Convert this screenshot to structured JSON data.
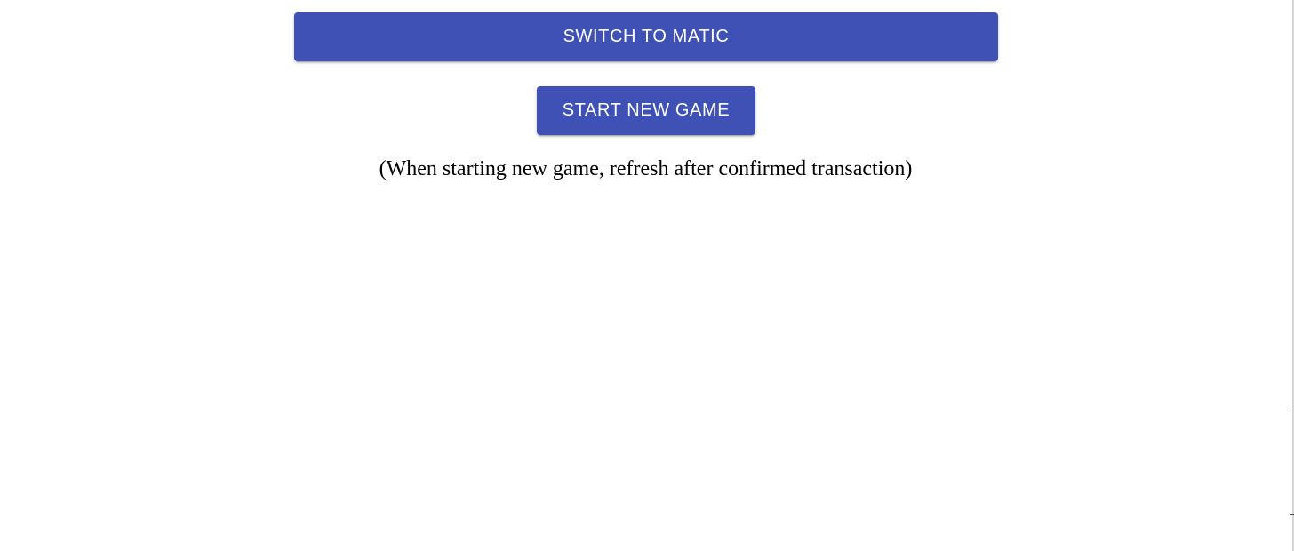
{
  "colors": {
    "primary_button": "#3f51b5",
    "background": "#ffffff",
    "text": "#000000"
  },
  "actions": {
    "switch_label": "SWITCH TO MATIC",
    "start_label": "START NEW GAME"
  },
  "notice": {
    "text": "(When starting new game, refresh after confirmed transaction)"
  }
}
